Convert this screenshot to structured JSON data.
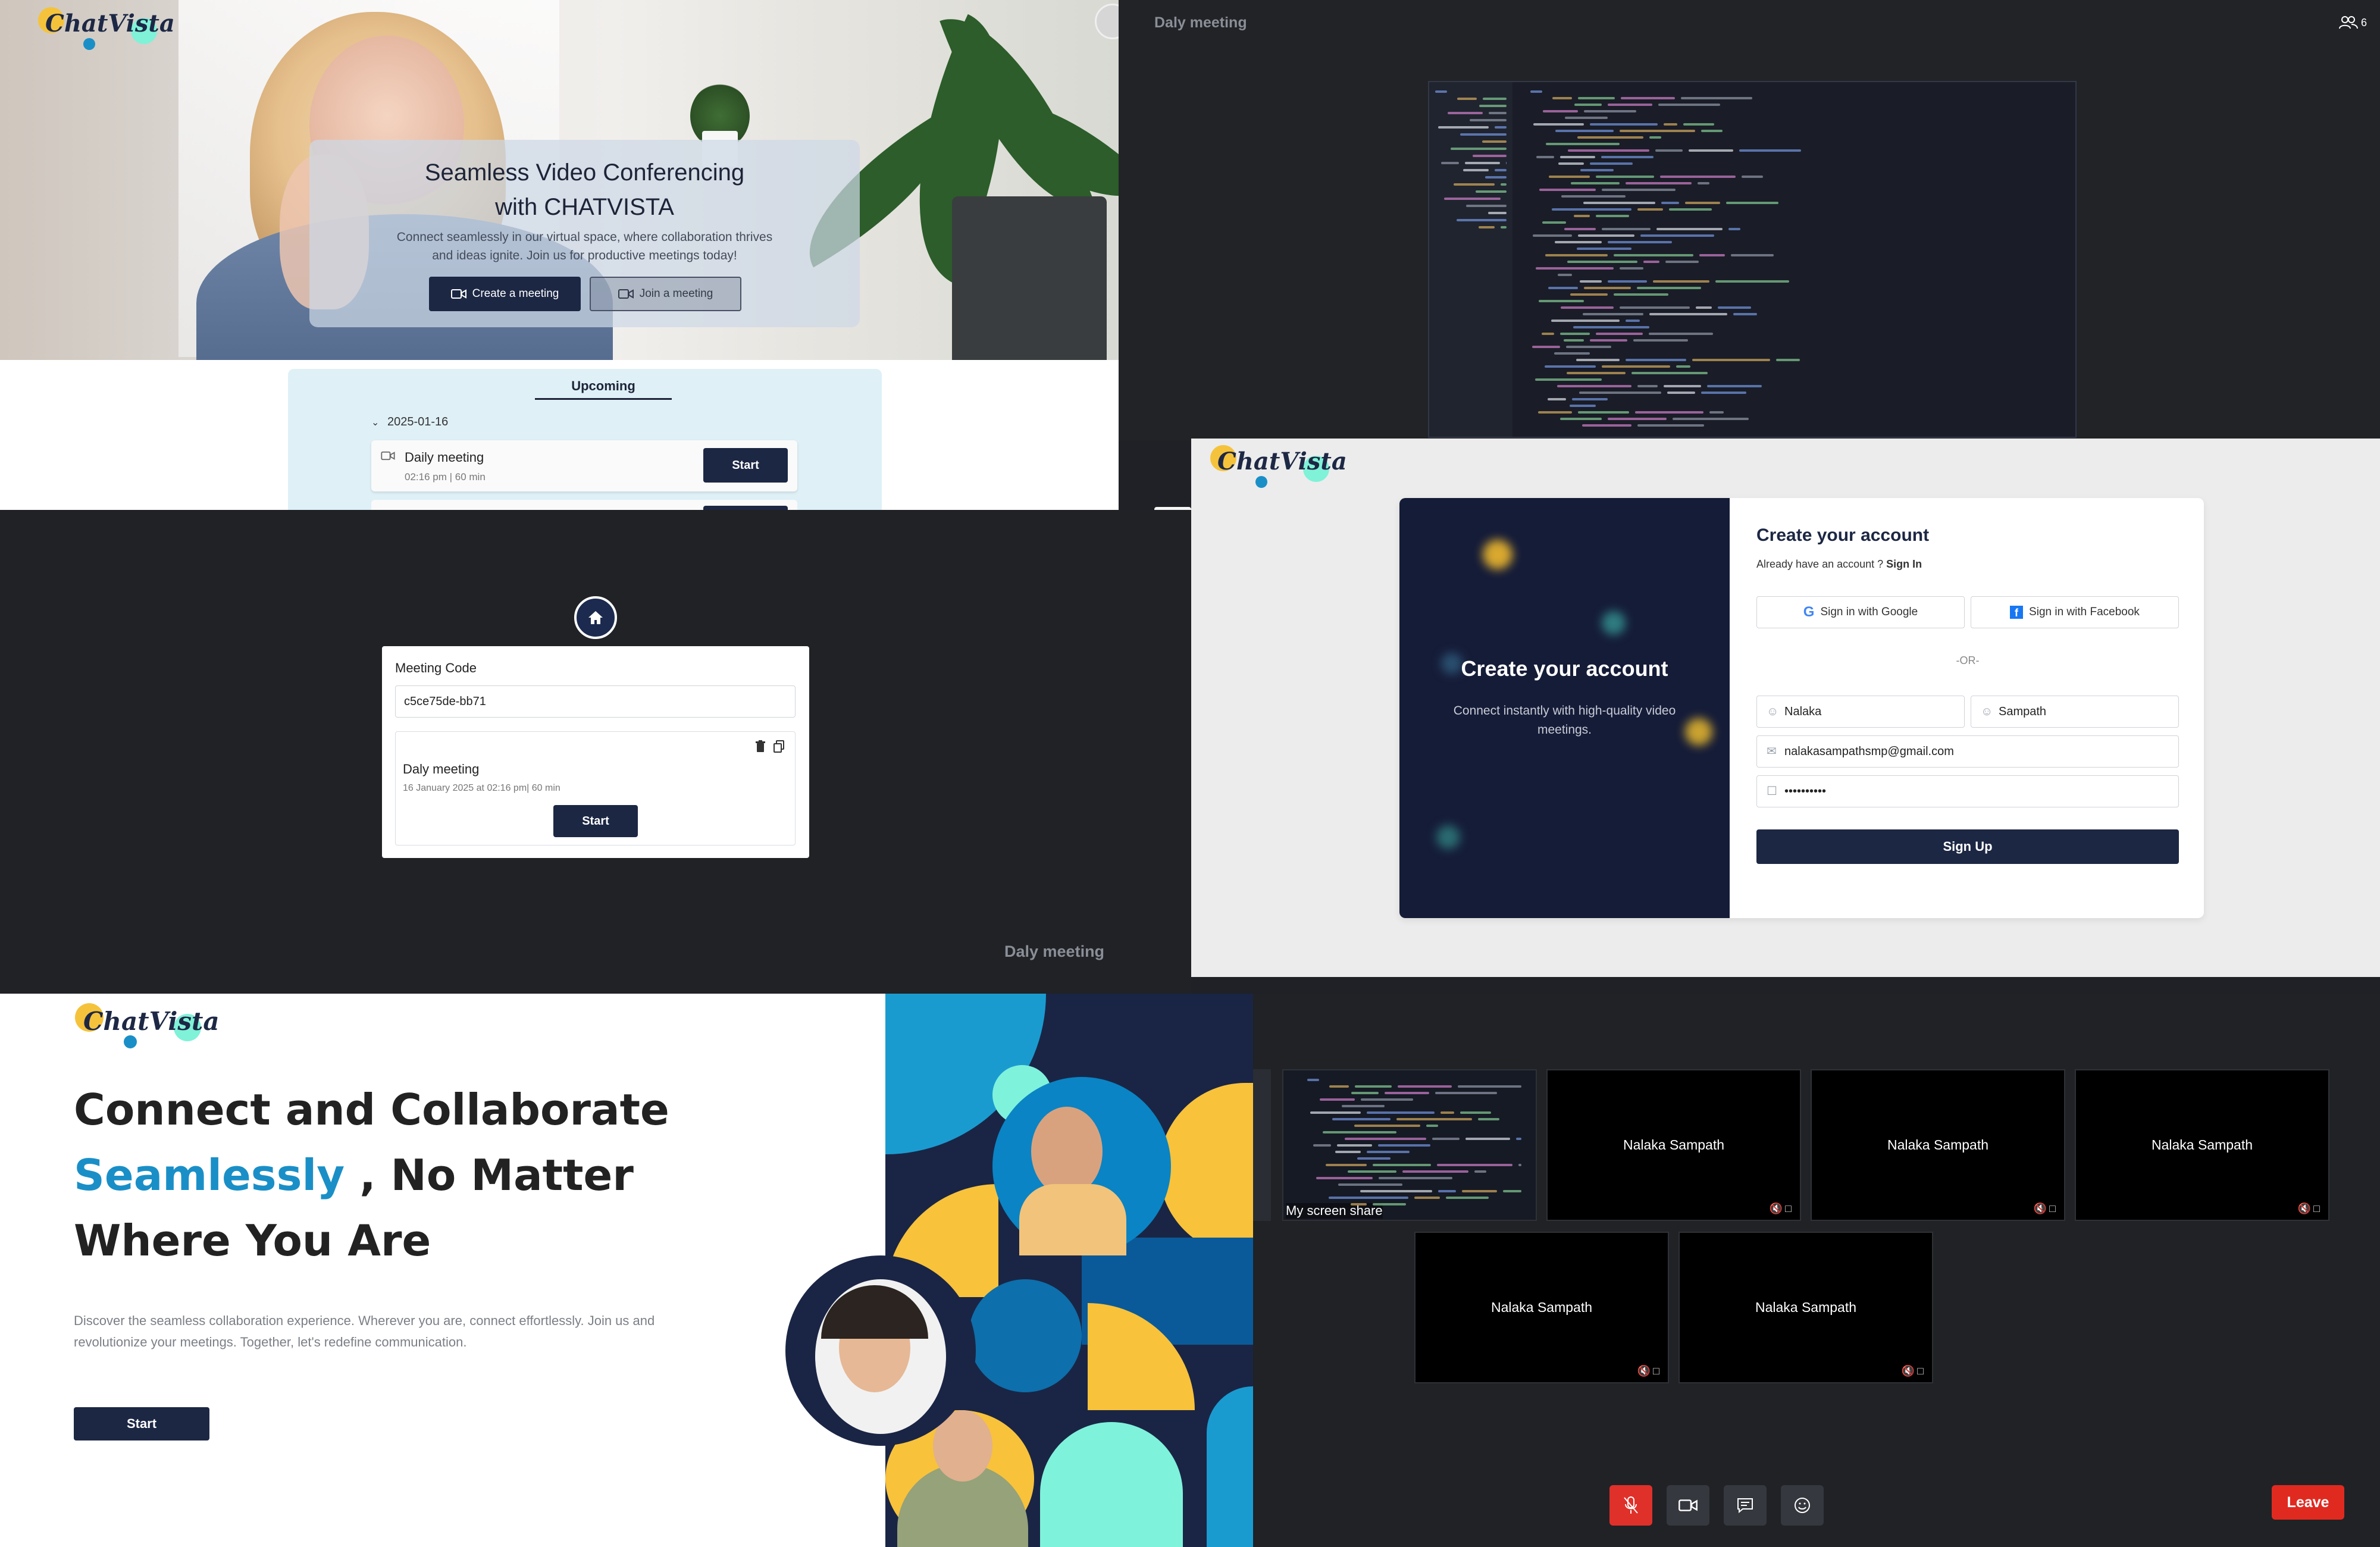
{
  "hero": {
    "logo": "ChatVista",
    "title_line1": "Seamless Video Conferencing",
    "title_line2": "with CHATVISTA",
    "subtitle": "Connect seamlessly in our virtual space, where collaboration thrives and ideas ignite. Join us for productive meetings today!",
    "create_label": "Create a meeting",
    "join_label": "Join a meeting"
  },
  "upcoming": {
    "title": "Upcoming",
    "date": "2025-01-16",
    "meeting_name": "Daily meeting",
    "meeting_meta": "02:16 pm  |  60 min",
    "start_label": "Start"
  },
  "share": {
    "title": "Daly meeting",
    "participants_count": "6",
    "cut_text": "c5ce"
  },
  "code_panel": {
    "label": "Meeting Code",
    "code_value": "c5ce75de-bb71",
    "meeting_name": "Daly meeting",
    "meeting_meta": "16 January 2025 at 02:16 pm| 60 min",
    "start_label": "Start",
    "footer_title": "Daly meeting"
  },
  "signup": {
    "logo": "ChatVista",
    "left_title": "Create your account",
    "left_sub": "Connect instantly with high-quality video meetings.",
    "title": "Create your account",
    "already": "Already have an account ?",
    "sign_in": "Sign In",
    "google_label": "Sign in with Google",
    "facebook_label": "Sign in with Facebook",
    "or": "-OR-",
    "first_name": "Nalaka",
    "last_name": "Sampath",
    "email": "nalakasampathsmp@gmail.com",
    "password": "••••••••••",
    "submit_label": "Sign Up"
  },
  "landing": {
    "logo": "ChatVista",
    "line1": "Connect and Collaborate",
    "line2_accent": "Seamlessly",
    "line2_rest": " , No Matter",
    "line3": "Where You Are",
    "description": "Discover the seamless collaboration experience. Wherever you are, connect effortlessly. Join us and revolutionize your meetings. Together, let's redefine communication.",
    "start_label": "Start"
  },
  "grid": {
    "screen_share_label": "My screen share",
    "participants": [
      "Nalaka Sampath",
      "Nalaka Sampath",
      "Nalaka Sampath",
      "Nalaka Sampath",
      "Nalaka Sampath"
    ],
    "leave_label": "Leave"
  },
  "colors": {
    "navy": "#1c2744",
    "accent_blue": "#1a8fc7",
    "leave_red": "#e02a20",
    "upcoming_bg": "#dff0f7"
  }
}
